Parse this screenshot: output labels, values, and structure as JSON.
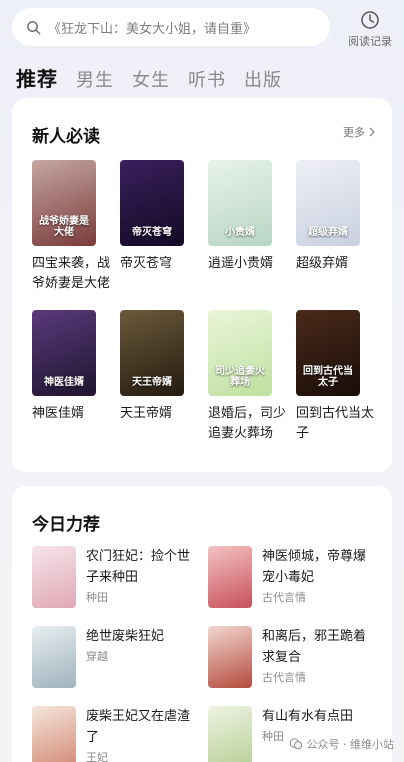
{
  "search": {
    "placeholder": "《狂龙下山：美女大小姐，请自重》"
  },
  "history": {
    "label": "阅读记录"
  },
  "tabs": [
    {
      "label": "推荐",
      "active": true
    },
    {
      "label": "男生",
      "active": false
    },
    {
      "label": "女生",
      "active": false
    },
    {
      "label": "听书",
      "active": false
    },
    {
      "label": "出版",
      "active": false
    }
  ],
  "new_section": {
    "title": "新人必读",
    "more": "更多",
    "books": [
      {
        "title": "四宝来袭，战爷娇妻是大佬",
        "cover_text": "战爷娇妻是大佬",
        "color_a": "#c5a6a0",
        "color_b": "#7a3b3b"
      },
      {
        "title": "帝灭苍穹",
        "cover_text": "帝灭苍穹",
        "color_a": "#3a1f5c",
        "color_b": "#120a24"
      },
      {
        "title": "逍遥小贵婿",
        "cover_text": "小贵婿",
        "color_a": "#e7f2ea",
        "color_b": "#b8d6c4"
      },
      {
        "title": "超级弃婿",
        "cover_text": "超级弃婿",
        "color_a": "#eef0f5",
        "color_b": "#c9d0e0"
      },
      {
        "title": "神医佳婿",
        "cover_text": "神医佳婿",
        "color_a": "#5a3a7a",
        "color_b": "#1e1430"
      },
      {
        "title": "天王帝婿",
        "cover_text": "天王帝婿",
        "color_a": "#6b5a3a",
        "color_b": "#241b10"
      },
      {
        "title": "退婚后，司少追妻火葬场",
        "cover_text": "司少追妻火葬场",
        "color_a": "#eaf5d8",
        "color_b": "#bfe0a0"
      },
      {
        "title": "回到古代当太子",
        "cover_text": "回到古代当太子",
        "color_a": "#4a2a1a",
        "color_b": "#1a0d08"
      }
    ]
  },
  "today_section": {
    "title": "今日力荐",
    "items": [
      {
        "title": "农门狂妃：捡个世子来种田",
        "genre": "种田",
        "color_a": "#f6e4e8",
        "color_b": "#e0a8b6"
      },
      {
        "title": "神医倾城，帝尊爆宠小毒妃",
        "genre": "古代言情",
        "color_a": "#f3c3c3",
        "color_b": "#c8505a"
      },
      {
        "title": "绝世废柴狂妃",
        "genre": "穿越",
        "color_a": "#e8eef0",
        "color_b": "#9fb3bd"
      },
      {
        "title": "和离后，邪王跪着求复合",
        "genre": "古代言情",
        "color_a": "#f2d7d0",
        "color_b": "#b44a3c"
      },
      {
        "title": "废柴王妃又在虐渣了",
        "genre": "王妃",
        "color_a": "#f5e6dc",
        "color_b": "#d38a74"
      },
      {
        "title": "有山有水有点田",
        "genre": "种田",
        "color_a": "#eef3e2",
        "color_b": "#b7cf95"
      }
    ]
  },
  "watermark": {
    "text": "公众号 · 维维小站"
  }
}
